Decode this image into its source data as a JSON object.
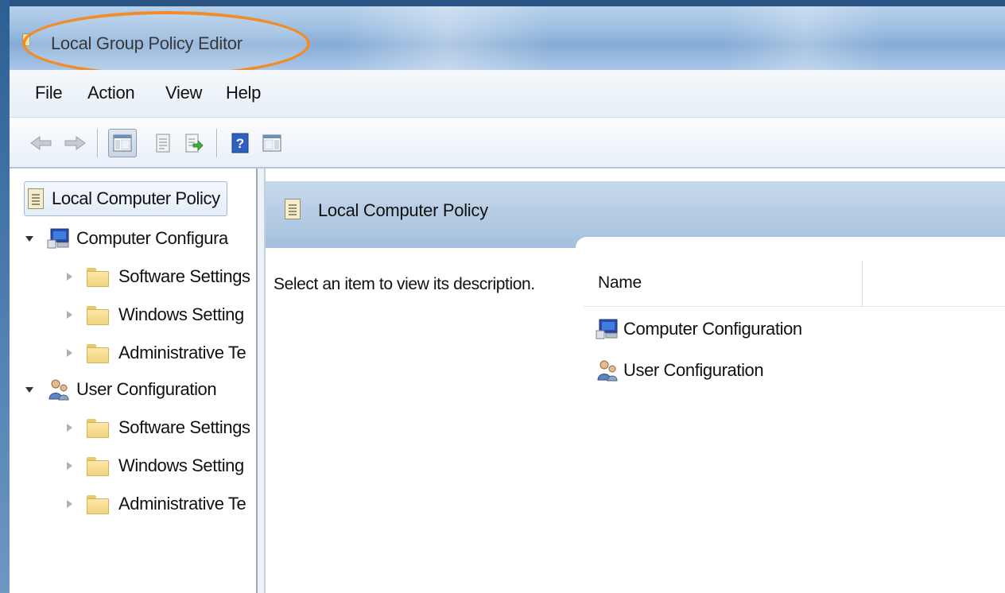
{
  "window": {
    "title": "Local Group Policy Editor"
  },
  "menubar": {
    "items": [
      "File",
      "Action",
      "View",
      "Help"
    ]
  },
  "toolbar": {
    "buttons": [
      "back-arrow-icon",
      "forward-arrow-icon",
      "show-hide-console-tree-icon",
      "properties-icon",
      "export-list-icon",
      "help-icon",
      "show-hide-action-pane-icon"
    ]
  },
  "tree": {
    "root": "Local Computer Policy",
    "nodes": [
      {
        "label": "Computer Configura",
        "icon": "computer-icon",
        "children": [
          "Software Settings",
          "Windows Setting",
          "Administrative Te"
        ]
      },
      {
        "label": "User Configuration",
        "icon": "user-icon",
        "children": [
          "Software Settings",
          "Windows Setting",
          "Administrative Te"
        ]
      }
    ]
  },
  "detail": {
    "header_title": "Local Computer Policy",
    "description": "Select an item to view its description.",
    "column_name": "Name",
    "items": [
      "Computer Configuration",
      "User Configuration"
    ]
  },
  "colors": {
    "title_bar": "#9dbfe2",
    "highlight_ellipse": "#f08c2a",
    "header_band": "#a4bfdc"
  }
}
